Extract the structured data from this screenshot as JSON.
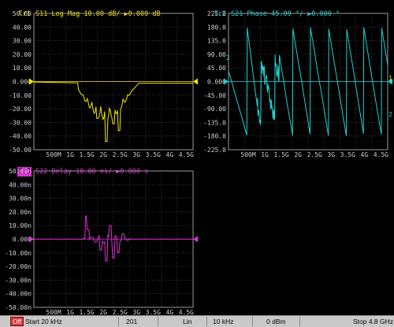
{
  "traces": [
    {
      "id": "tr1",
      "badge": "Tr1",
      "title": " S11 Log Mag 10.00 dB/ ▶0.000 dB",
      "color": "#f2e600",
      "badge_bg": "",
      "y_ticks": [
        "50.00",
        "40.00",
        "30.00",
        "20.00",
        "10.00",
        "0.000",
        "-10.00",
        "-20.00",
        "-30.00",
        "-40.00",
        "-50.00"
      ],
      "x_ticks": [
        "500M",
        "1G",
        "1.5G",
        "2G",
        "2.5G",
        "3G",
        "3.5G",
        "4G",
        "4.5G"
      ],
      "reference_value": "0.000"
    },
    {
      "id": "tr2",
      "badge": "Tr2",
      "title": " S21 Phase 45.00 °/ ▶0.000 °",
      "color": "#1ed2d2",
      "badge_bg": "",
      "y_ticks": [
        "225.0",
        "180.0",
        "135.0",
        "90.00",
        "45.00",
        "0.000",
        "-45.00",
        "-90.00",
        "-135.0",
        "-180.0",
        "-225.0"
      ],
      "x_ticks": [
        "500M",
        "1G",
        "1.5G",
        "2G",
        "2.5G",
        "3G",
        "3.5G",
        "4G",
        "4.5G"
      ],
      "reference_value": "0.000"
    },
    {
      "id": "tr3",
      "badge": "Tr3",
      "title": " S22 Delay 10.00 ns/ ▶0.000 s",
      "color": "#e12ed6",
      "badge_bg": "#e12ed6",
      "y_ticks": [
        "50.00n",
        "40.00n",
        "30.00n",
        "20.00n",
        "10.00n",
        "0.000",
        "-10.00n",
        "-20.00n",
        "-30.00n",
        "-40.00n",
        "-50.00n"
      ],
      "x_ticks": [
        "500M",
        "1G",
        "1.5G",
        "2G",
        "2.5G",
        "3G",
        "3.5G",
        "4G",
        "4.5G"
      ],
      "reference_value": "0.000"
    }
  ],
  "trace_markers": {
    "tr1_right": "1",
    "tr2_left": "2",
    "tr2_right": "2"
  },
  "status": {
    "off": "Off",
    "start": "Start 20 kHz",
    "points": "201",
    "sweep_type": "Lin",
    "ifbw": "10 kHz",
    "power": "0 dBm",
    "stop": "Stop 4.8 GHz"
  },
  "chart_data": [
    {
      "type": "line",
      "trace": "Tr1",
      "measurement": "S11 Log Mag",
      "x_unit": "Hz",
      "y_unit": "dB",
      "xlim": [
        20000,
        4800000000
      ],
      "ylim": [
        -50,
        50
      ],
      "x": [
        20000.0,
        500000000.0,
        1000000000.0,
        1200000000.0,
        1400000000.0,
        1500000000.0,
        1600000000.0,
        1700000000.0,
        1800000000.0,
        1900000000.0,
        2000000000.0,
        2100000000.0,
        2200000000.0,
        2300000000.0,
        2400000000.0,
        2500000000.0,
        2600000000.0,
        2700000000.0,
        2800000000.0,
        3000000000.0,
        3500000000.0,
        4000000000.0,
        4500000000.0,
        4800000000.0
      ],
      "y": [
        0,
        -1,
        -1.5,
        -2,
        -3,
        -6,
        -12,
        -8,
        -15,
        -20,
        -10,
        -18,
        -45,
        -20,
        -30,
        -35,
        -15,
        -28,
        -12,
        -3,
        -2,
        -1,
        -1,
        0
      ]
    },
    {
      "type": "line",
      "trace": "Tr2",
      "measurement": "S21 Phase",
      "x_unit": "Hz",
      "y_unit": "deg",
      "xlim": [
        20000,
        4800000000
      ],
      "ylim": [
        -225,
        225
      ],
      "x": [
        20000.0,
        500000000.0,
        1000000000.0,
        1500000000.0,
        2000000000.0,
        2500000000.0,
        3000000000.0,
        3500000000.0,
        4000000000.0,
        4500000000.0,
        4800000000.0
      ],
      "y": [
        0,
        120,
        -150,
        160,
        -170,
        150,
        -160,
        170,
        -150,
        160,
        -100
      ]
    },
    {
      "type": "line",
      "trace": "Tr3",
      "measurement": "S22 Delay",
      "x_unit": "Hz",
      "y_unit": "s",
      "xlim": [
        20000,
        4800000000
      ],
      "ylim": [
        -5e-08,
        5e-08
      ],
      "x": [
        20000.0,
        1000000000.0,
        1400000000.0,
        1500000000.0,
        1600000000.0,
        1800000000.0,
        2000000000.0,
        2100000000.0,
        2200000000.0,
        2500000000.0,
        2600000000.0,
        2800000000.0,
        3000000000.0,
        4800000000.0
      ],
      "y": [
        0,
        0,
        2e-09,
        1.7e-08,
        6e-09,
        -8e-09,
        1e-08,
        -1.6e-08,
        -6e-09,
        5e-09,
        -1.5e-08,
        -3e-09,
        1e-09,
        0
      ]
    }
  ]
}
